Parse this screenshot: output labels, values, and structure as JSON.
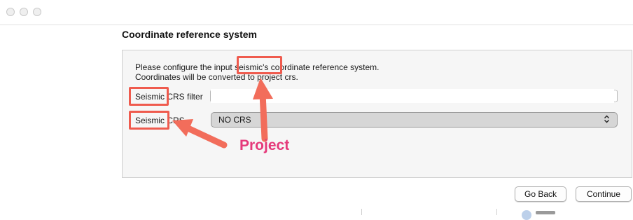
{
  "window": {
    "controls": [
      "close",
      "minimize",
      "zoom"
    ]
  },
  "section": {
    "title": "Coordinate reference system"
  },
  "intro": {
    "line1_prefix": "Please configure the input ",
    "line1_highlight": "seismic's",
    "line1_suffix": " coordinate reference system.",
    "line2": "Coordinates will be converted to project crs."
  },
  "filter": {
    "label_highlight": "Seismic",
    "label_suffix": " CRS filter",
    "value": "",
    "placeholder": ""
  },
  "crs": {
    "label_highlight": "Seismic",
    "label_suffix": " CRS",
    "selected": "NO CRS",
    "indicator": "⌃⌄"
  },
  "annotation": {
    "text": "Project",
    "box_color": "#ef5b4e",
    "text_color": "#e5397a",
    "arrow_color": "#f26d5b"
  },
  "footer": {
    "back_label": "Go Back",
    "continue_label": "Continue"
  }
}
